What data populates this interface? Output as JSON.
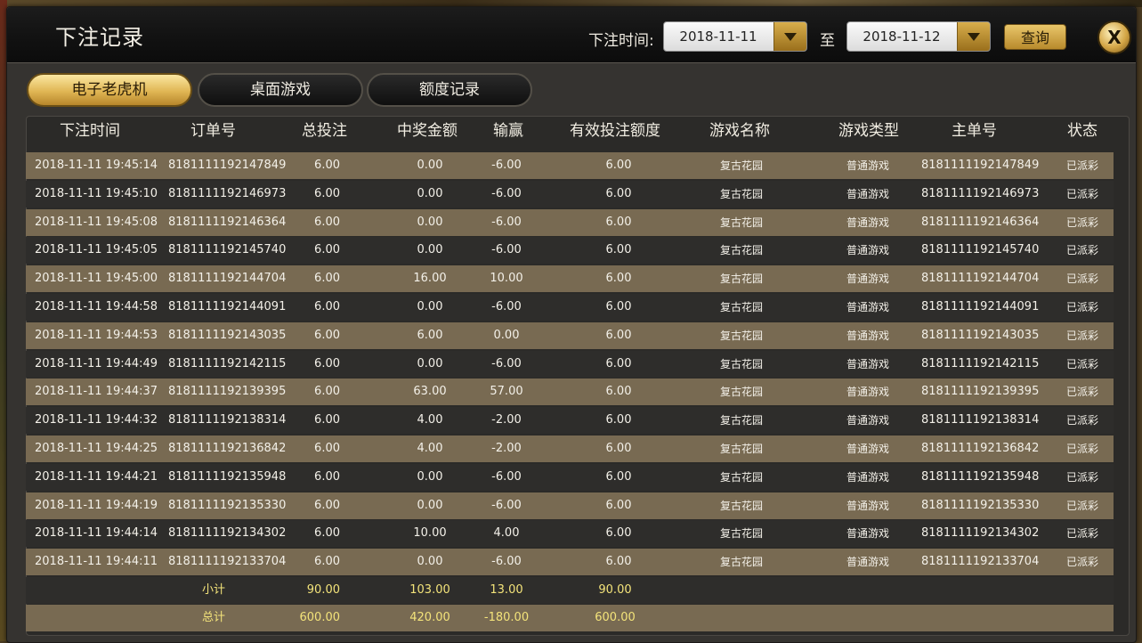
{
  "header": {
    "title": "下注记录",
    "date_label": "下注时间:",
    "start_date": "2018-11-11",
    "to_label": "至",
    "end_date": "2018-11-12",
    "query_label": "查询",
    "close_label": "X"
  },
  "tabs": [
    {
      "label": "电子老虎机",
      "active": true
    },
    {
      "label": "桌面游戏",
      "active": false
    },
    {
      "label": "额度记录",
      "active": false
    }
  ],
  "columns": [
    "下注时间",
    "订单号",
    "总投注",
    "中奖金额",
    "输赢",
    "有效投注额度",
    "游戏名称",
    "游戏类型",
    "主单号",
    "状态"
  ],
  "rows": [
    {
      "time": "2018-11-11 19:45:14",
      "order": "8181111192147849",
      "bet": "6.00",
      "win": "0.00",
      "net": "-6.00",
      "valid": "6.00",
      "game": "复古花园",
      "type": "普通游戏",
      "master": "8181111192147849",
      "status": "已派彩"
    },
    {
      "time": "2018-11-11 19:45:10",
      "order": "8181111192146973",
      "bet": "6.00",
      "win": "0.00",
      "net": "-6.00",
      "valid": "6.00",
      "game": "复古花园",
      "type": "普通游戏",
      "master": "8181111192146973",
      "status": "已派彩"
    },
    {
      "time": "2018-11-11 19:45:08",
      "order": "8181111192146364",
      "bet": "6.00",
      "win": "0.00",
      "net": "-6.00",
      "valid": "6.00",
      "game": "复古花园",
      "type": "普通游戏",
      "master": "8181111192146364",
      "status": "已派彩"
    },
    {
      "time": "2018-11-11 19:45:05",
      "order": "8181111192145740",
      "bet": "6.00",
      "win": "0.00",
      "net": "-6.00",
      "valid": "6.00",
      "game": "复古花园",
      "type": "普通游戏",
      "master": "8181111192145740",
      "status": "已派彩"
    },
    {
      "time": "2018-11-11 19:45:00",
      "order": "8181111192144704",
      "bet": "6.00",
      "win": "16.00",
      "net": "10.00",
      "valid": "6.00",
      "game": "复古花园",
      "type": "普通游戏",
      "master": "8181111192144704",
      "status": "已派彩"
    },
    {
      "time": "2018-11-11 19:44:58",
      "order": "8181111192144091",
      "bet": "6.00",
      "win": "0.00",
      "net": "-6.00",
      "valid": "6.00",
      "game": "复古花园",
      "type": "普通游戏",
      "master": "8181111192144091",
      "status": "已派彩"
    },
    {
      "time": "2018-11-11 19:44:53",
      "order": "8181111192143035",
      "bet": "6.00",
      "win": "6.00",
      "net": "0.00",
      "valid": "6.00",
      "game": "复古花园",
      "type": "普通游戏",
      "master": "8181111192143035",
      "status": "已派彩"
    },
    {
      "time": "2018-11-11 19:44:49",
      "order": "8181111192142115",
      "bet": "6.00",
      "win": "0.00",
      "net": "-6.00",
      "valid": "6.00",
      "game": "复古花园",
      "type": "普通游戏",
      "master": "8181111192142115",
      "status": "已派彩"
    },
    {
      "time": "2018-11-11 19:44:37",
      "order": "8181111192139395",
      "bet": "6.00",
      "win": "63.00",
      "net": "57.00",
      "valid": "6.00",
      "game": "复古花园",
      "type": "普通游戏",
      "master": "8181111192139395",
      "status": "已派彩"
    },
    {
      "time": "2018-11-11 19:44:32",
      "order": "8181111192138314",
      "bet": "6.00",
      "win": "4.00",
      "net": "-2.00",
      "valid": "6.00",
      "game": "复古花园",
      "type": "普通游戏",
      "master": "8181111192138314",
      "status": "已派彩"
    },
    {
      "time": "2018-11-11 19:44:25",
      "order": "8181111192136842",
      "bet": "6.00",
      "win": "4.00",
      "net": "-2.00",
      "valid": "6.00",
      "game": "复古花园",
      "type": "普通游戏",
      "master": "8181111192136842",
      "status": "已派彩"
    },
    {
      "time": "2018-11-11 19:44:21",
      "order": "8181111192135948",
      "bet": "6.00",
      "win": "0.00",
      "net": "-6.00",
      "valid": "6.00",
      "game": "复古花园",
      "type": "普通游戏",
      "master": "8181111192135948",
      "status": "已派彩"
    },
    {
      "time": "2018-11-11 19:44:19",
      "order": "8181111192135330",
      "bet": "6.00",
      "win": "0.00",
      "net": "-6.00",
      "valid": "6.00",
      "game": "复古花园",
      "type": "普通游戏",
      "master": "8181111192135330",
      "status": "已派彩"
    },
    {
      "time": "2018-11-11 19:44:14",
      "order": "8181111192134302",
      "bet": "6.00",
      "win": "10.00",
      "net": "4.00",
      "valid": "6.00",
      "game": "复古花园",
      "type": "普通游戏",
      "master": "8181111192134302",
      "status": "已派彩"
    },
    {
      "time": "2018-11-11 19:44:11",
      "order": "8181111192133704",
      "bet": "6.00",
      "win": "0.00",
      "net": "-6.00",
      "valid": "6.00",
      "game": "复古花园",
      "type": "普通游戏",
      "master": "8181111192133704",
      "status": "已派彩"
    }
  ],
  "subtotal": {
    "label": "小计",
    "bet": "90.00",
    "win": "103.00",
    "net": "13.00",
    "valid": "90.00"
  },
  "total": {
    "label": "总计",
    "bet": "600.00",
    "win": "420.00",
    "net": "-180.00",
    "valid": "600.00"
  },
  "colors": {
    "accent_gold": "#e0b654",
    "row_odd": "#786a52",
    "row_even": "#2e2d2b",
    "sum_text": "#f3e37a"
  }
}
